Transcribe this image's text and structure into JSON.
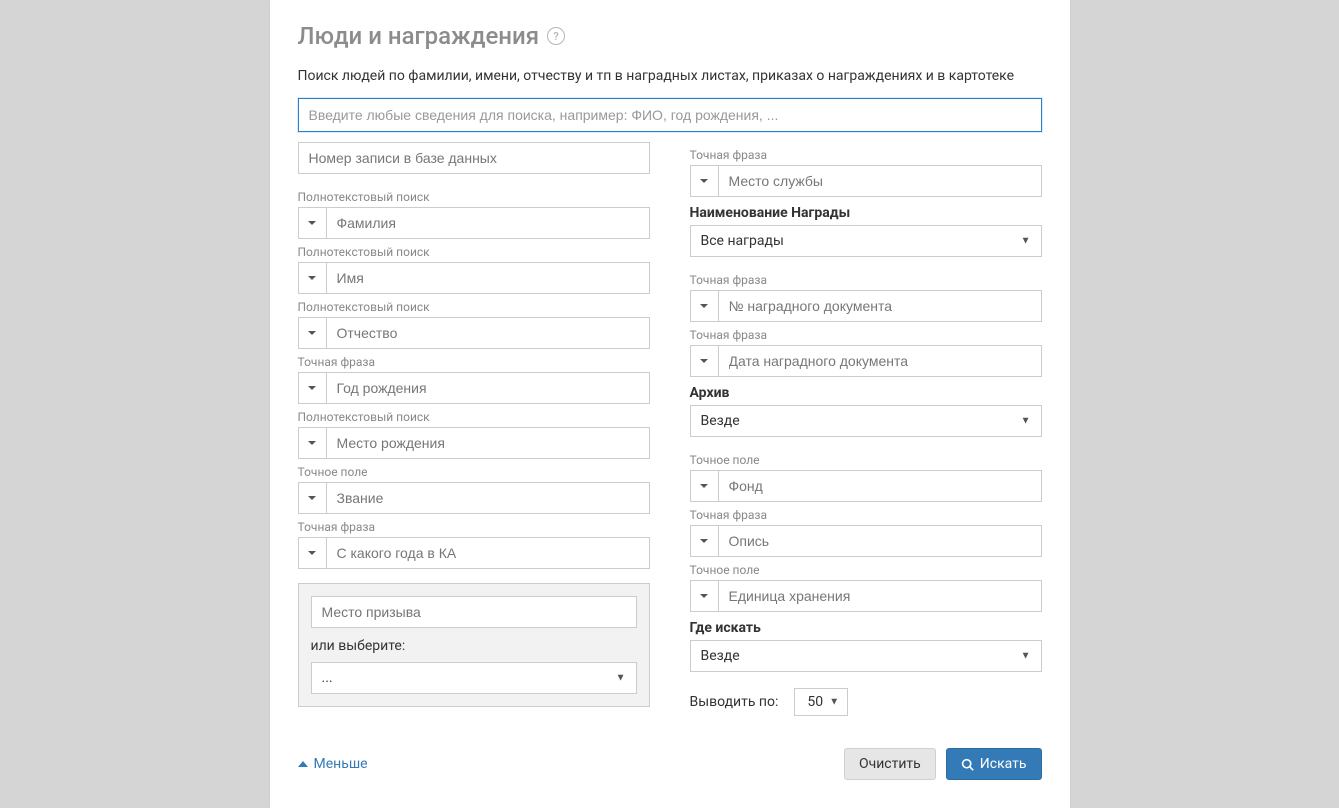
{
  "title": "Люди и награждения",
  "description": "Поиск людей по фамилии, имени, отчеству и тп в наградных листах, приказах о награждениях и в картотеке",
  "main_search_placeholder": "Введите любые сведения для поиска, например: ФИО, год рождения, ...",
  "record_id_placeholder": "Номер записи в базе данных",
  "labels": {
    "fulltext": "Полнотекстовый поиск",
    "exact_phrase": "Точная фраза",
    "exact_field": "Точное поле",
    "award_name": "Наименование Награды",
    "archive": "Архив",
    "where_search": "Где искать",
    "page_size": "Выводить по:",
    "or_select": "или выберите:",
    "less": "Меньше",
    "clear": "Очистить",
    "search": "Искать"
  },
  "left": {
    "lastname": "Фамилия",
    "firstname": "Имя",
    "patronymic": "Отчество",
    "birth_year": "Год рождения",
    "birth_place": "Место рождения",
    "rank": "Звание",
    "since_year": "С какого года в КА",
    "callout_place": "Место призыва",
    "callout_select": "..."
  },
  "right": {
    "service_place": "Место службы",
    "all_awards": "Все награды",
    "doc_number": "№ наградного документа",
    "doc_date": "Дата наградного документа",
    "archive_value": "Везде",
    "fond": "Фонд",
    "opis": "Опись",
    "unit": "Единица хранения",
    "where_value": "Везде",
    "page_size_value": "50"
  }
}
